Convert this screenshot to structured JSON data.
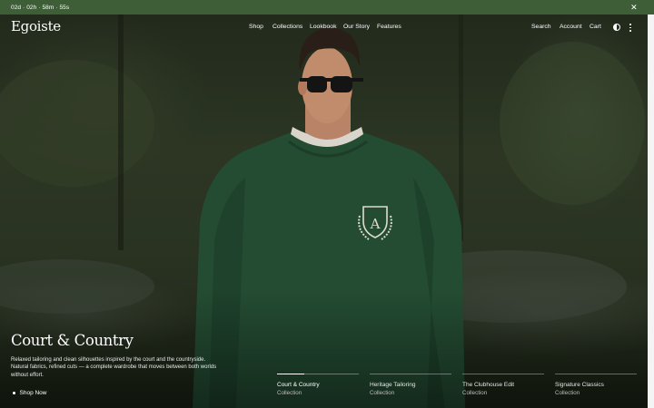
{
  "announcement": {
    "countdown": "02d · 02h · 58m · 55s",
    "close_icon": "close-icon"
  },
  "header": {
    "logo": "Egoiste",
    "nav": [
      "Shop",
      "Collections",
      "Lookbook",
      "Our Story",
      "Features"
    ],
    "search": "Search",
    "account": "Account",
    "cart": "Cart",
    "contrast_icon": "contrast-icon",
    "more_icon": "more-vertical-icon"
  },
  "hero": {
    "title": "Court & Country",
    "description": "Relaxed tailoring and clean silhouettes inspired by the court and the countryside. Natural fabrics, refined cuts — a complete wardrobe that moves between both worlds without effort.",
    "cta": "Shop Now"
  },
  "collections": [
    {
      "label": "Court & Country",
      "sub": "Collection",
      "active": true,
      "progress": 0.33
    },
    {
      "label": "Heritage Tailoring",
      "sub": "Collection",
      "active": false,
      "progress": 0
    },
    {
      "label": "The Clubhouse Edit",
      "sub": "Collection",
      "active": false,
      "progress": 0
    },
    {
      "label": "Signature Classics",
      "sub": "Collection",
      "active": false,
      "progress": 0
    }
  ],
  "colors": {
    "announcement_bg": "#3d5e36",
    "sweater": "#244c33"
  }
}
